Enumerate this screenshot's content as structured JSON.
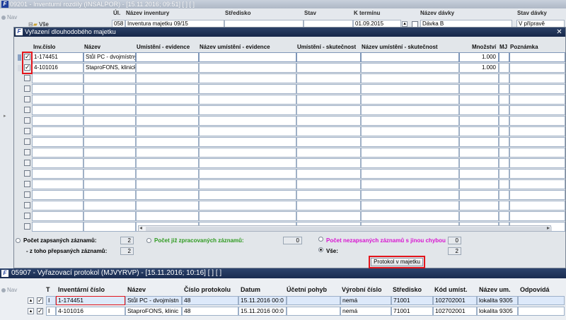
{
  "bg_window": {
    "title": "09201 - Inventurní rozdíly (INSALPOR) - [15.11.2016; 09:51]  [ ]  [ ]",
    "nav_label": "Nav",
    "tree_label": "Vše",
    "headers": [
      "Úl.",
      "Název inventury",
      "Středisko",
      "Stav",
      "K termínu",
      "Název dávky",
      "Stav dávky"
    ],
    "row": {
      "ul": "058",
      "name": "Inventura majetku 09/15",
      "stredisko": "",
      "stav": "",
      "termin": "01.09.2015",
      "davka": "Dávka B",
      "stav_davky": "V přípravě"
    }
  },
  "dialog": {
    "title": "Vyřazení dlouhodobého majetku",
    "columns": [
      "Inv.číslo",
      "Název",
      "Umístění - evidence",
      "Název umístění - evidence",
      "Umístění - skutečnost",
      "Název umístění - skutečnost",
      "Množství",
      "MJ",
      "Poznámka"
    ],
    "rows": [
      {
        "inv": "1-174451",
        "name": "Stůl PC - dvojmístný s",
        "qty": "1.000",
        "checked": true
      },
      {
        "inv": "4-101016",
        "name": "StaproFONS, klinický",
        "qty": "1.000",
        "checked": true
      }
    ],
    "empty_row_count": 15,
    "summary": {
      "zapsanych_label": "Počet zapsaných záznamů:",
      "zapsanych_value": "2",
      "prepsanych_label": "- z toho přepsaných záznamů:",
      "prepsanych_value": "2",
      "zpracovanych_label": "Počet již zpracovaných záznamů:",
      "zpracovanych_value": "0",
      "nezapsanych_label": "Počet nezapsaných záznamů s jinou chybou :",
      "nezapsanych_value": "0",
      "vse_label": "Vše:",
      "vse_value": "2"
    },
    "protocol_button": "Protokol v majetku",
    "colors": {
      "green_label": "#2e9a1f",
      "magenta_label": "#d815d0",
      "highlight": "#e3141b"
    }
  },
  "bottom_window": {
    "title": "05907 - Vyřazovací protokol (MJVYRVP) - [15.11.2016; 10:16]  [ ]  [ ]",
    "nav_label": "Nav",
    "headers": [
      "T",
      "Inventární číslo",
      "Název",
      "Číslo protokolu",
      "Datum",
      "Účetní pohyb",
      "Výrobní číslo",
      "Středisko",
      "Kód umíst.",
      "Název um.",
      "Odpovídá"
    ],
    "rows": [
      {
        "t": "I",
        "inv": "1-174451",
        "name": "Stůl PC - dvojmístn",
        "protokol": "48",
        "datum": "15.11.2016 00:0",
        "ucetni": "",
        "vyrobni": "nemá",
        "stredisko": "71001",
        "kod": "102702001",
        "nazev_um": "lokalita 9305",
        "odpovida": ""
      },
      {
        "t": "I",
        "inv": "4-101016",
        "name": "StaproFONS, klinic",
        "protokol": "48",
        "datum": "15.11.2016 00:0",
        "ucetni": "",
        "vyrobni": "nemá",
        "stredisko": "71001",
        "kod": "102702001",
        "nazev_um": "lokalita 9305",
        "odpovida": ""
      }
    ]
  }
}
